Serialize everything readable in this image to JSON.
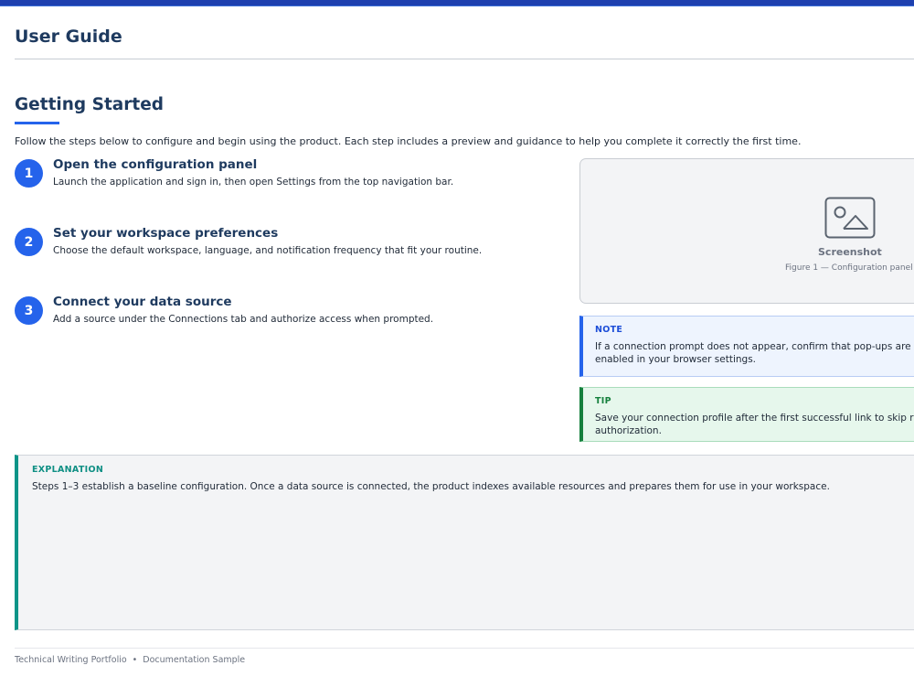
{
  "header": {
    "title": "User Guide"
  },
  "section": {
    "heading": "Getting Started",
    "intro": "Follow the steps below to configure and begin using the product. Each step includes a preview and guidance to help you complete it correctly the first time."
  },
  "steps": [
    {
      "number": "1",
      "title": "Open the configuration panel",
      "description": "Launch the application and sign in, then open Settings from the top navigation bar."
    },
    {
      "number": "2",
      "title": "Set your workspace preferences",
      "description": "Choose the default workspace, language, and notification frequency that fit your routine."
    },
    {
      "number": "3",
      "title": "Connect your data source",
      "description": "Add a source under the Connections tab and authorize access when prompted."
    }
  ],
  "screenshot": {
    "icon": "image-icon",
    "label": "Screenshot",
    "caption": "Figure 1 — Configuration panel"
  },
  "note": {
    "label": "NOTE",
    "text": "If a connection prompt does not appear, confirm that pop-ups are enabled in your browser settings."
  },
  "tip": {
    "label": "TIP",
    "text": "Save your connection profile after the first successful link to skip re-authorization."
  },
  "explanation": {
    "label": "EXPLANATION",
    "text": "Steps 1–3 establish a baseline configuration. Once a data source is connected, the product indexes available resources and prepares them for use in your workspace."
  },
  "footer": {
    "left": "Technical Writing Portfolio",
    "separator": "•",
    "right": "Documentation Sample"
  },
  "colors": {
    "accent": "#2563eb",
    "heading": "#1e3a5f",
    "note_border": "#2563eb",
    "tip_border": "#15803d",
    "explanation_border": "#0d9488"
  }
}
